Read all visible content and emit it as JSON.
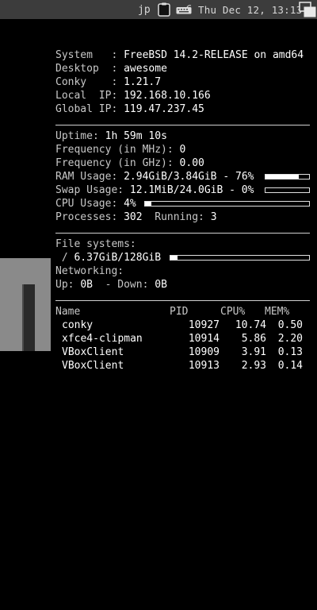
{
  "topbar": {
    "keyboard_layout": "jp",
    "clipboard_icon": "clipboard-icon",
    "keyboard_icon": "keyboard-icon",
    "clock": "Thu Dec 12, 13:13",
    "layout_icon": "floating-layout-icon"
  },
  "system": {
    "system_label": "System   :",
    "system_value": "FreeBSD 14.2-RELEASE on amd64",
    "desktop_label": "Desktop  :",
    "desktop_value": "awesome",
    "conky_label": "Conky    :",
    "conky_value": "1.21.7",
    "local_ip_label": "Local  IP:",
    "local_ip_value": "192.168.10.166",
    "global_ip_label": "Global IP:",
    "global_ip_value": "119.47.237.45"
  },
  "stats": {
    "uptime_label": "Uptime:",
    "uptime_value": "1h 59m 10s",
    "freq_mhz_label": "Frequency (in MHz):",
    "freq_mhz_value": "0",
    "freq_ghz_label": "Frequency (in GHz):",
    "freq_ghz_value": "0.00",
    "ram_label": "RAM Usage:",
    "ram_value": "2.94GiB/3.84GiB - 76%",
    "ram_percent": 76,
    "swap_label": "Swap Usage:",
    "swap_value": "12.1MiB/24.0GiB - 0%",
    "swap_percent": 0,
    "cpu_label": "CPU Usage:",
    "cpu_value": "4%",
    "cpu_percent": 4,
    "processes_label": "Processes:",
    "processes_value": "302",
    "running_label": "Running:",
    "running_value": "3"
  },
  "filesystems": {
    "title": "File systems:",
    "root_label": " /",
    "root_value": "6.37GiB/128GiB",
    "root_percent": 5,
    "networking_label": "Networking:",
    "up_label": "Up:",
    "up_value": "0B",
    "down_label": " - Down:",
    "down_value": "0B"
  },
  "processes": {
    "headers": {
      "name": "Name",
      "pid": "PID",
      "cpu": "CPU%",
      "mem": "MEM%"
    },
    "rows": [
      {
        "name": "conky",
        "pid": "10927",
        "cpu": "10.74",
        "mem": "0.50"
      },
      {
        "name": "xfce4-clipman",
        "pid": "10914",
        "cpu": "5.86",
        "mem": "2.20"
      },
      {
        "name": "VBoxClient",
        "pid": "10909",
        "cpu": "3.91",
        "mem": "0.13"
      },
      {
        "name": "VBoxClient",
        "pid": "10913",
        "cpu": "2.93",
        "mem": "0.14"
      }
    ]
  }
}
